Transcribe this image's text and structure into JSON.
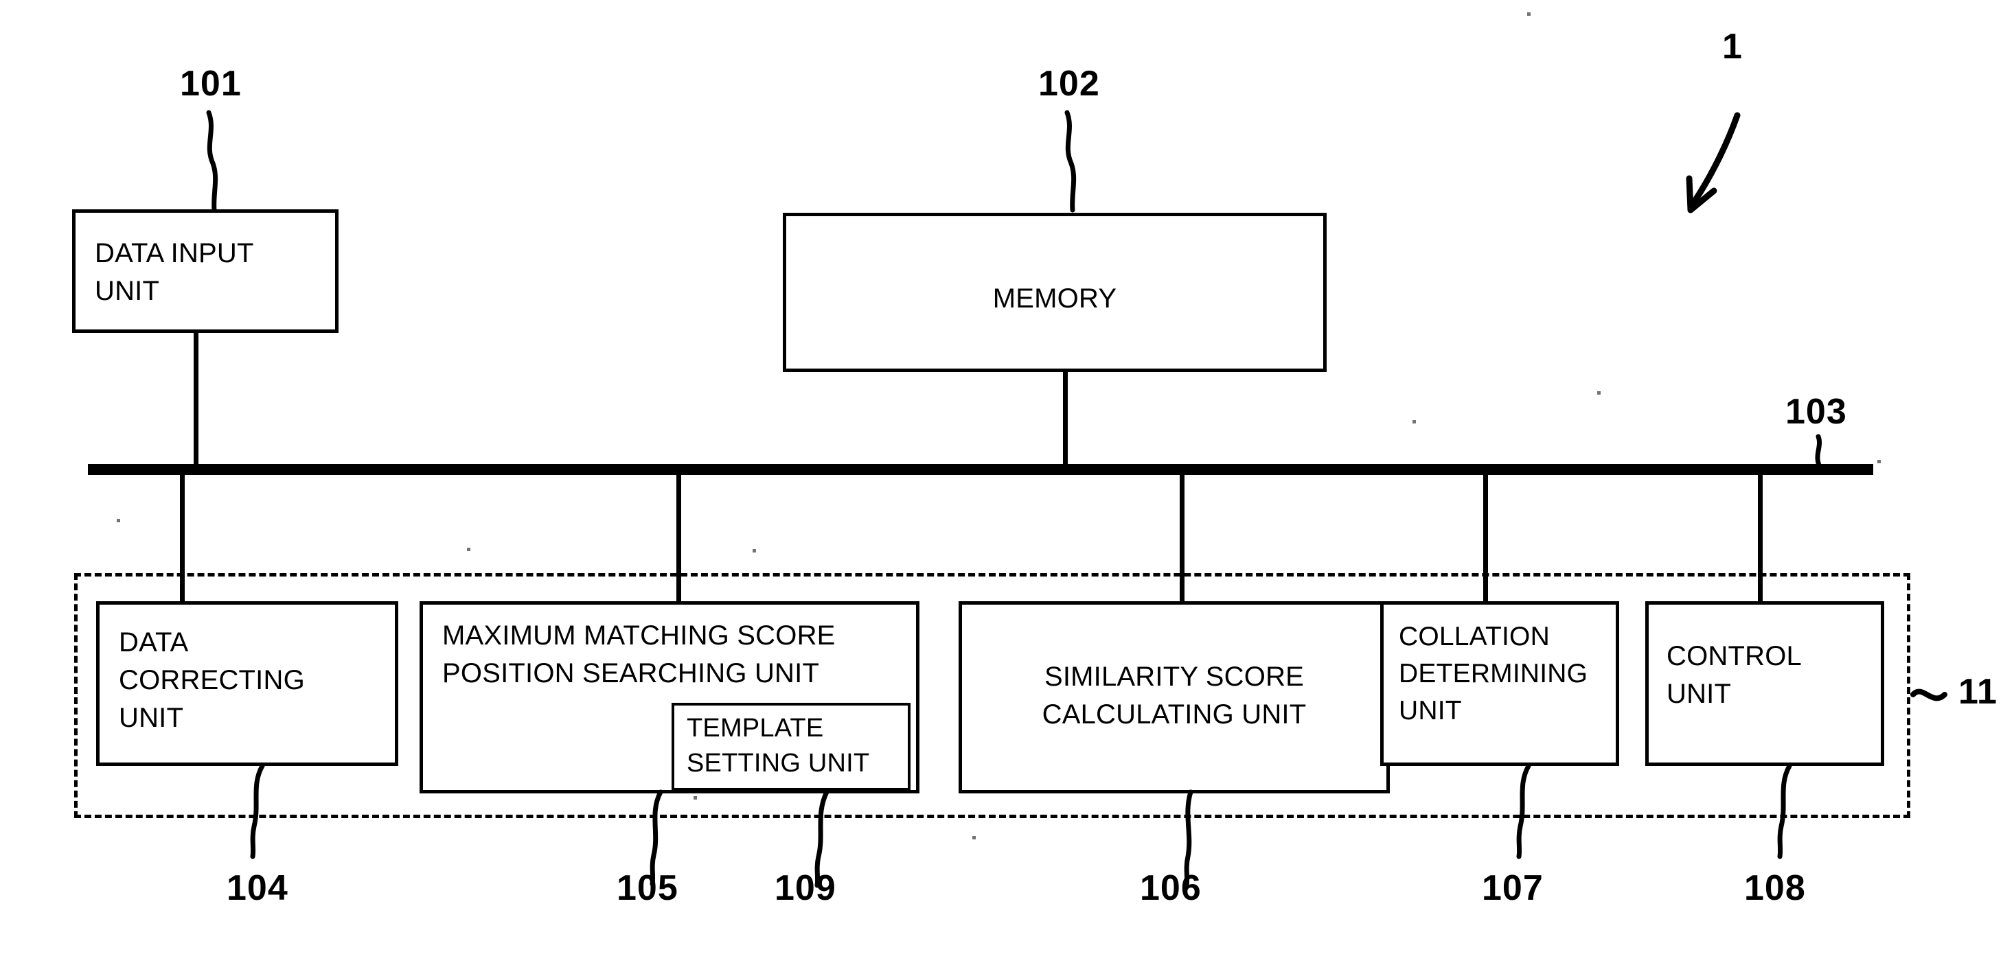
{
  "figure": {
    "type": "patent-block-diagram",
    "system_reference": "1",
    "background_color": "#ffffff",
    "line_color": "#000000"
  },
  "blocks": {
    "data_input_unit": {
      "label": "DATA INPUT\nUNIT",
      "ref": "101"
    },
    "memory": {
      "label": "MEMORY",
      "ref": "102"
    },
    "bus": {
      "label": "",
      "ref": "103"
    },
    "data_correcting": {
      "label": "DATA\nCORRECTING\nUNIT",
      "ref": "104"
    },
    "max_matching": {
      "label": "MAXIMUM MATCHING SCORE\nPOSITION SEARCHING UNIT",
      "ref": "105"
    },
    "similarity_score": {
      "label": "SIMILARITY SCORE\nCALCULATING UNIT",
      "ref": "106"
    },
    "collation": {
      "label": "COLLATION\nDETERMINING\nUNIT",
      "ref": "107"
    },
    "control": {
      "label": "CONTROL\nUNIT",
      "ref": "108"
    },
    "template_setting": {
      "label": "TEMPLATE\nSETTING UNIT",
      "ref": "109"
    },
    "processing_region": {
      "label": "",
      "ref": "11"
    }
  }
}
